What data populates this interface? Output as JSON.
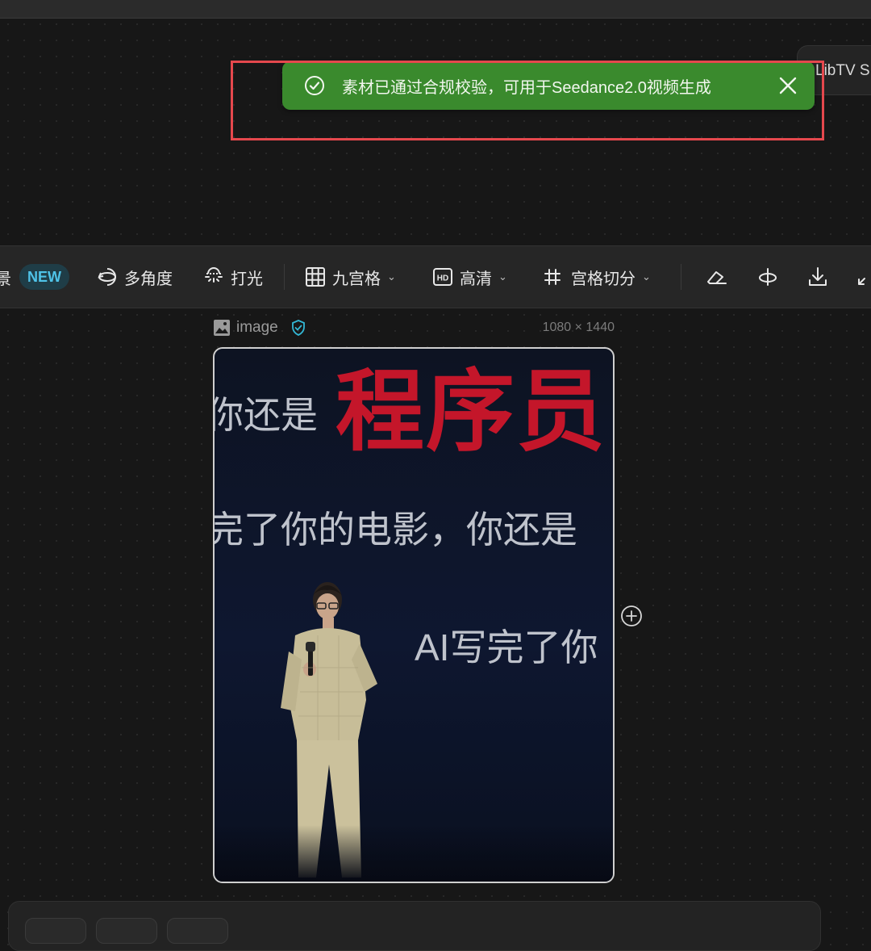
{
  "right_chip": {
    "label": "LibTV S"
  },
  "toast": {
    "message": "素材已通过合规校验，可用于Seedance2.0视频生成",
    "check_icon": "check-circle-icon",
    "close_icon": "close-icon",
    "background_color": "#3a8a2d"
  },
  "toolbar": {
    "cut_label": "景",
    "new_badge": "NEW",
    "multi_angle": "多角度",
    "lighting": "打光",
    "nine_grid": "九宫格",
    "hd": "高清",
    "grid_split": "宫格切分"
  },
  "image_node": {
    "name": "image",
    "dimensions": "1080 × 1440"
  },
  "photo": {
    "headline": "程序员",
    "line1": "你还是",
    "line2": "完了你的电影，你还是",
    "line3": "AI写完了你"
  },
  "colors": {
    "accent_badge": "#4fc3e8",
    "headline_red": "#c4162a",
    "highlight_border": "#e5484d"
  }
}
